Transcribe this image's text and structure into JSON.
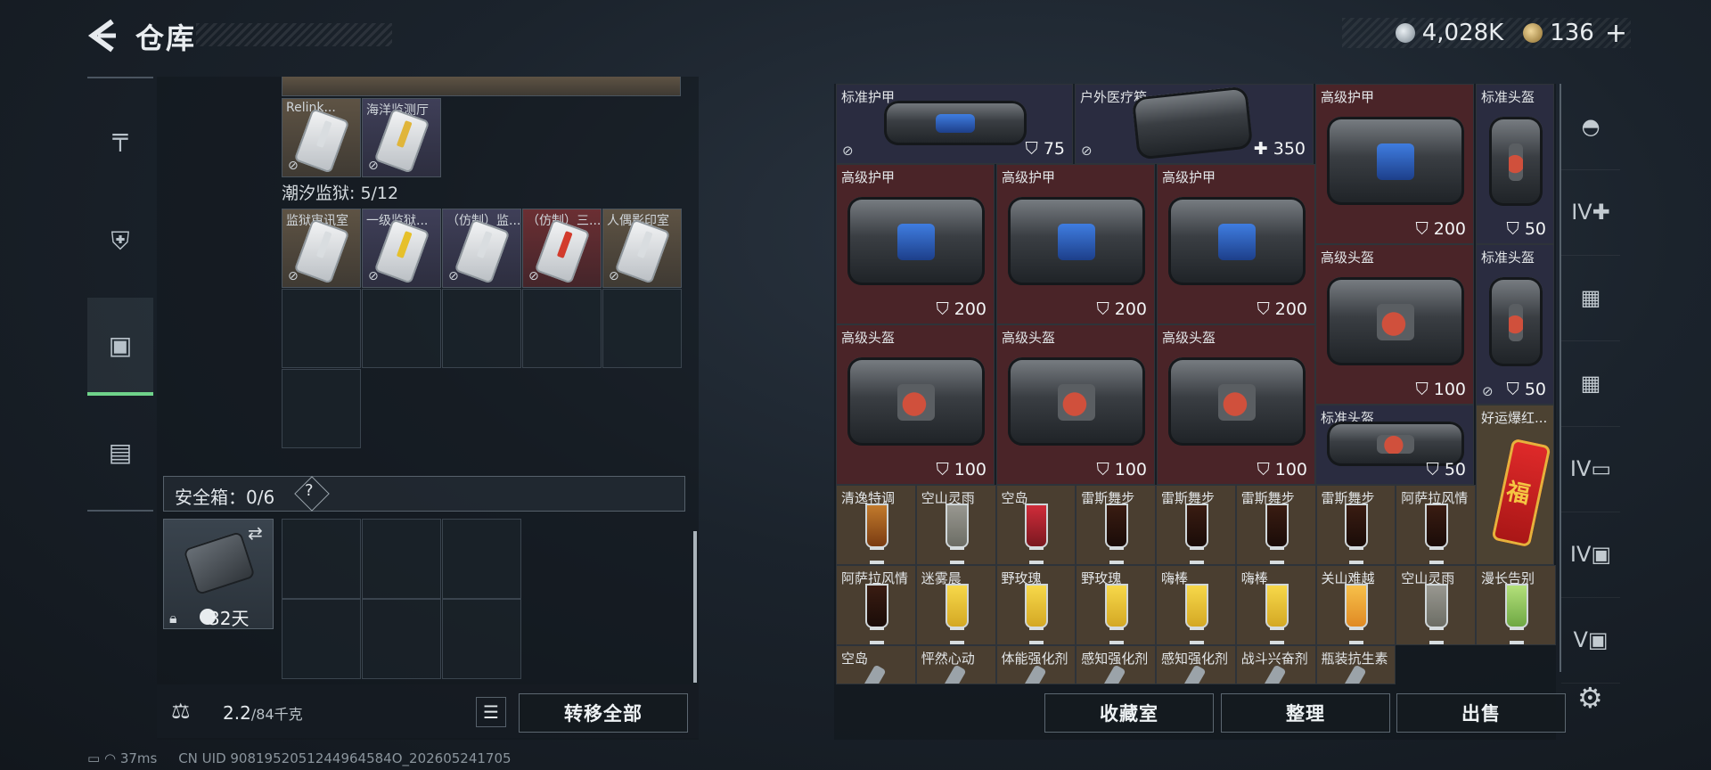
{
  "header": {
    "back_icon": "back-arrow-icon",
    "title": "仓库"
  },
  "currency": [
    {
      "icon": "silver-coin-icon",
      "value": "4,028K"
    },
    {
      "icon": "gold-coin-icon",
      "value": "136",
      "plus": "+"
    }
  ],
  "left_nav": [
    {
      "icon": "gun-icon",
      "glyph": "╤",
      "active": false
    },
    {
      "icon": "armor-icon",
      "glyph": "⛨",
      "active": false
    },
    {
      "icon": "backpack-icon",
      "glyph": "▣",
      "active": true
    },
    {
      "icon": "briefcase-icon",
      "glyph": "▤",
      "active": false
    }
  ],
  "keycards_top": [
    {
      "label": "Relink...",
      "bg": "tan",
      "stripe": "#d9dde0"
    },
    {
      "label": "海洋监测厅",
      "bg": "purple",
      "stripe": "#e0b53a"
    }
  ],
  "section": {
    "label": "潮汐监狱: 5/12"
  },
  "keycards_row": [
    {
      "label": "监狱审讯室",
      "bg": "tan",
      "stripe": "#d9dde0"
    },
    {
      "label": "一级监狱...",
      "bg": "purple",
      "stripe": "#e6c02a"
    },
    {
      "label": "（仿制）监...",
      "bg": "purple",
      "stripe": "#d9dde0"
    },
    {
      "label": "（仿制）三...",
      "bg": "red",
      "stripe": "#d23b2c"
    },
    {
      "label": "人偶影印室",
      "bg": "tan",
      "stripe": "#d9dde0"
    }
  ],
  "safebox": {
    "label": "安全箱：0/6",
    "help": "?",
    "days": "32天"
  },
  "bottom_left": {
    "weight_value": "2.2",
    "weight_cap": "/84千克",
    "transfer_all": "转移全部"
  },
  "bottom_right": {
    "collection": "收藏室",
    "organize": "整理",
    "sell": "出售"
  },
  "inventory": {
    "armor_bags": [
      {
        "label": "标准护甲",
        "stat": "75",
        "stat_icon": "shield-icon",
        "win": "blue",
        "color": "purple",
        "nosale": true
      },
      {
        "label": "户外医疗箱",
        "stat": "350",
        "stat_icon": "plus-icon",
        "win": "none",
        "color": "purple",
        "nosale": true
      },
      {
        "label": "高级护甲",
        "stat": "200",
        "stat_icon": "shield-icon",
        "win": "blue",
        "color": "red",
        "nosale": false
      },
      {
        "label": "标准头盔",
        "stat": "50",
        "stat_icon": "shield-icon",
        "win": "red",
        "color": "purple",
        "nosale": false
      },
      {
        "label": "高级护甲",
        "stat": "200",
        "stat_icon": "shield-icon",
        "win": "blue",
        "color": "red",
        "nosale": false
      },
      {
        "label": "高级护甲",
        "stat": "200",
        "stat_icon": "shield-icon",
        "win": "blue",
        "color": "red",
        "nosale": false
      },
      {
        "label": "高级护甲",
        "stat": "200",
        "stat_icon": "shield-icon",
        "win": "blue",
        "color": "red",
        "nosale": false
      },
      {
        "label": "高级头盔",
        "stat": "100",
        "stat_icon": "shield-icon",
        "win": "red",
        "color": "red",
        "nosale": false
      },
      {
        "label": "标准头盔",
        "stat": "50",
        "stat_icon": "shield-icon",
        "win": "red",
        "color": "purple",
        "nosale": true
      },
      {
        "label": "高级头盔",
        "stat": "100",
        "stat_icon": "shield-icon",
        "win": "red",
        "color": "red",
        "nosale": false
      },
      {
        "label": "高级头盔",
        "stat": "100",
        "stat_icon": "shield-icon",
        "win": "red",
        "color": "red",
        "nosale": false
      },
      {
        "label": "高级头盔",
        "stat": "100",
        "stat_icon": "shield-icon",
        "win": "red",
        "color": "red",
        "nosale": false
      },
      {
        "label": "标准头盔",
        "stat": "50",
        "stat_icon": "shield-icon",
        "win": "red",
        "color": "purple",
        "nosale": false
      },
      {
        "label": "好运爆红...",
        "stat": "",
        "stat_icon": "",
        "win": "none",
        "color": "tan",
        "nosale": false
      }
    ],
    "drinks_row1": [
      {
        "label": "清逸特调",
        "glass": "amber"
      },
      {
        "label": "空山灵雨",
        "glass": "clear"
      },
      {
        "label": "空岛",
        "glass": "red"
      },
      {
        "label": "雷斯舞步",
        "glass": "cola"
      },
      {
        "label": "雷斯舞步",
        "glass": "cola"
      },
      {
        "label": "雷斯舞步",
        "glass": "cola"
      },
      {
        "label": "雷斯舞步",
        "glass": "cola"
      },
      {
        "label": "阿萨拉风情",
        "glass": "cola"
      }
    ],
    "drinks_row2": [
      {
        "label": "阿萨拉风情",
        "glass": "cola"
      },
      {
        "label": "迷雾晨",
        "glass": "yellow"
      },
      {
        "label": "野玫瑰",
        "glass": "yellow"
      },
      {
        "label": "野玫瑰",
        "glass": "yellow"
      },
      {
        "label": "嗨棒",
        "glass": "yellow"
      },
      {
        "label": "嗨棒",
        "glass": "yellow"
      },
      {
        "label": "关山难越",
        "glass": "orange"
      },
      {
        "label": "空山灵雨",
        "glass": "clear"
      },
      {
        "label": "漫长告别",
        "glass": "green"
      }
    ],
    "row3": [
      {
        "label": "空岛"
      },
      {
        "label": "怦然心动"
      },
      {
        "label": "体能强化剂"
      },
      {
        "label": "感知强化剂"
      },
      {
        "label": "感知强化剂"
      },
      {
        "label": "战斗兴奋剂"
      },
      {
        "label": "瓶装抗生素"
      }
    ]
  },
  "right_nav": [
    {
      "icon": "helmet-icon",
      "glyph": "◓"
    },
    {
      "icon": "medkit-lv4-icon",
      "glyph": "IV✚"
    },
    {
      "icon": "card-icon",
      "glyph": "▦"
    },
    {
      "icon": "card-icon",
      "glyph": "▦"
    },
    {
      "icon": "folder-lv4-icon",
      "glyph": "IV▭"
    },
    {
      "icon": "case-lv4-icon",
      "glyph": "IV▣"
    },
    {
      "icon": "case-lv5-icon",
      "glyph": "V▣"
    }
  ],
  "status": {
    "ping": "37ms",
    "uid": "CN UID 9081952051244964584O_202605241705"
  }
}
